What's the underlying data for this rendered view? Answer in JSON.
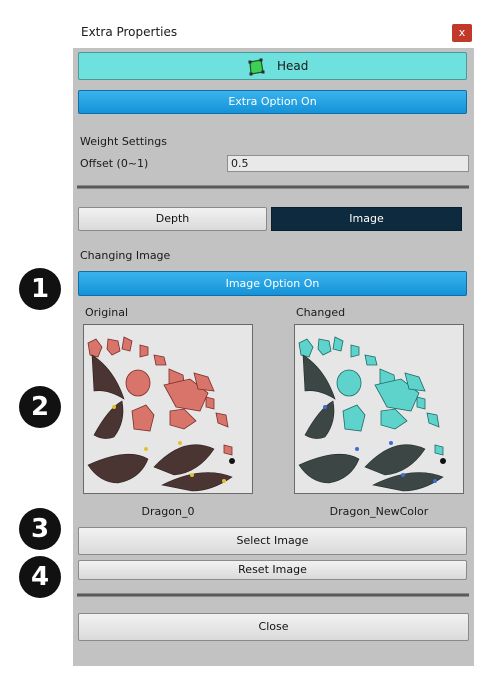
{
  "window": {
    "title": "Extra Properties",
    "close_glyph": "x"
  },
  "head": {
    "label": "Head",
    "icon": "bone-shape-icon",
    "color": "#6ee0de"
  },
  "extra_option_label": "Extra Option On",
  "weight": {
    "section_label": "Weight Settings",
    "offset_label": "Offset (0~1)",
    "offset_value": "0.5"
  },
  "tabs": {
    "depth": "Depth",
    "image": "Image",
    "active": "Image"
  },
  "changing": {
    "section_label": "Changing Image",
    "option_label": "Image Option On"
  },
  "images": {
    "original": {
      "label": "Original",
      "name": "Dragon_0",
      "tint": "#d8746a"
    },
    "changed": {
      "label": "Changed",
      "name": "Dragon_NewColor",
      "tint": "#5ed3cc"
    }
  },
  "buttons": {
    "select": "Select Image",
    "reset": "Reset Image",
    "close": "Close"
  },
  "badges": [
    "1",
    "2",
    "3",
    "4"
  ],
  "colors": {
    "accent_blue": "#1592d8",
    "active_tab": "#0e2a3e",
    "panel": "#c2c2c2"
  }
}
